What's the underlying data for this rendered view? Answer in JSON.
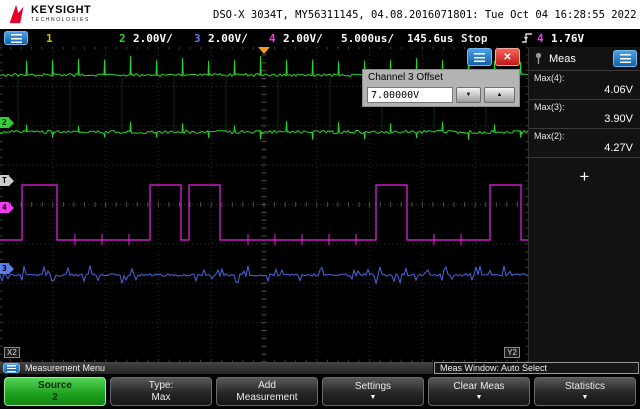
{
  "icons": {
    "close": "✕",
    "spinner_down": "▼",
    "spinner_up": "▲",
    "softkey_arrow": "▼"
  },
  "header": {
    "brand_name": "KEYSIGHT",
    "brand_sub": "TECHNOLOGIES",
    "title": "DSO-X 3034T, MY56311145, 04.08.2016071801: Tue Oct 04 16:28:55 2022"
  },
  "channel_bar": {
    "ch1_num": "1",
    "ch2_num": "2",
    "ch2_scale": "2.00V/",
    "ch3_num": "3",
    "ch3_scale": "2.00V/",
    "ch4_num": "4",
    "ch4_scale": "2.00V/",
    "timebase": "5.000us/",
    "delay": "145.6us",
    "run_state": "Stop",
    "trigger_source": "4",
    "trigger_level": "1.76V"
  },
  "dialog": {
    "title": "Channel 3 Offset",
    "value": "7.00000V"
  },
  "sidebar": {
    "title": "Meas",
    "items": [
      {
        "label": "Max(4):",
        "value": "4.06V"
      },
      {
        "label": "Max(3):",
        "value": "3.90V"
      },
      {
        "label": "Max(2):",
        "value": "4.27V"
      }
    ],
    "add_label": "+"
  },
  "status": {
    "menu_label": "Measurement Menu",
    "meas_window": "Meas Window: Auto Select"
  },
  "softkeys": [
    {
      "line1": "Source",
      "line2": "2"
    },
    {
      "line1": "Type:",
      "line2": "Max"
    },
    {
      "line1": "Add",
      "line2": "Measurement"
    },
    {
      "line1": "Settings"
    },
    {
      "line1": "Clear Meas"
    },
    {
      "line1": "Statistics"
    }
  ],
  "markers": {
    "ch2": "2",
    "trigger": "T",
    "ch4": "4",
    "ch3": "3",
    "x2": "X2",
    "y2": "Y2"
  },
  "colors": {
    "ch1": "#cfc00c",
    "ch2": "#2ed32e",
    "ch3": "#5b7fe8",
    "ch4": "#f03cf0",
    "accent_blue": "#1f7fd0",
    "close_red": "#d42020",
    "softkey_green": "#2db52d"
  },
  "waveforms": {
    "ch2": {
      "color": "#2bd42b",
      "rail_high": 28,
      "rail_low": 85
    },
    "ch4": {
      "color": "#ee22ee",
      "low": 193,
      "high": 138,
      "pulses": [
        [
          22,
          57
        ],
        [
          150,
          181
        ],
        [
          189,
          220
        ],
        [
          376,
          407
        ],
        [
          490,
          521
        ]
      ],
      "ticks": [
        75,
        102,
        129,
        248,
        275,
        302,
        329,
        356,
        434,
        461
      ]
    },
    "ch3": {
      "color": "#4a66e0",
      "base": 228
    }
  }
}
